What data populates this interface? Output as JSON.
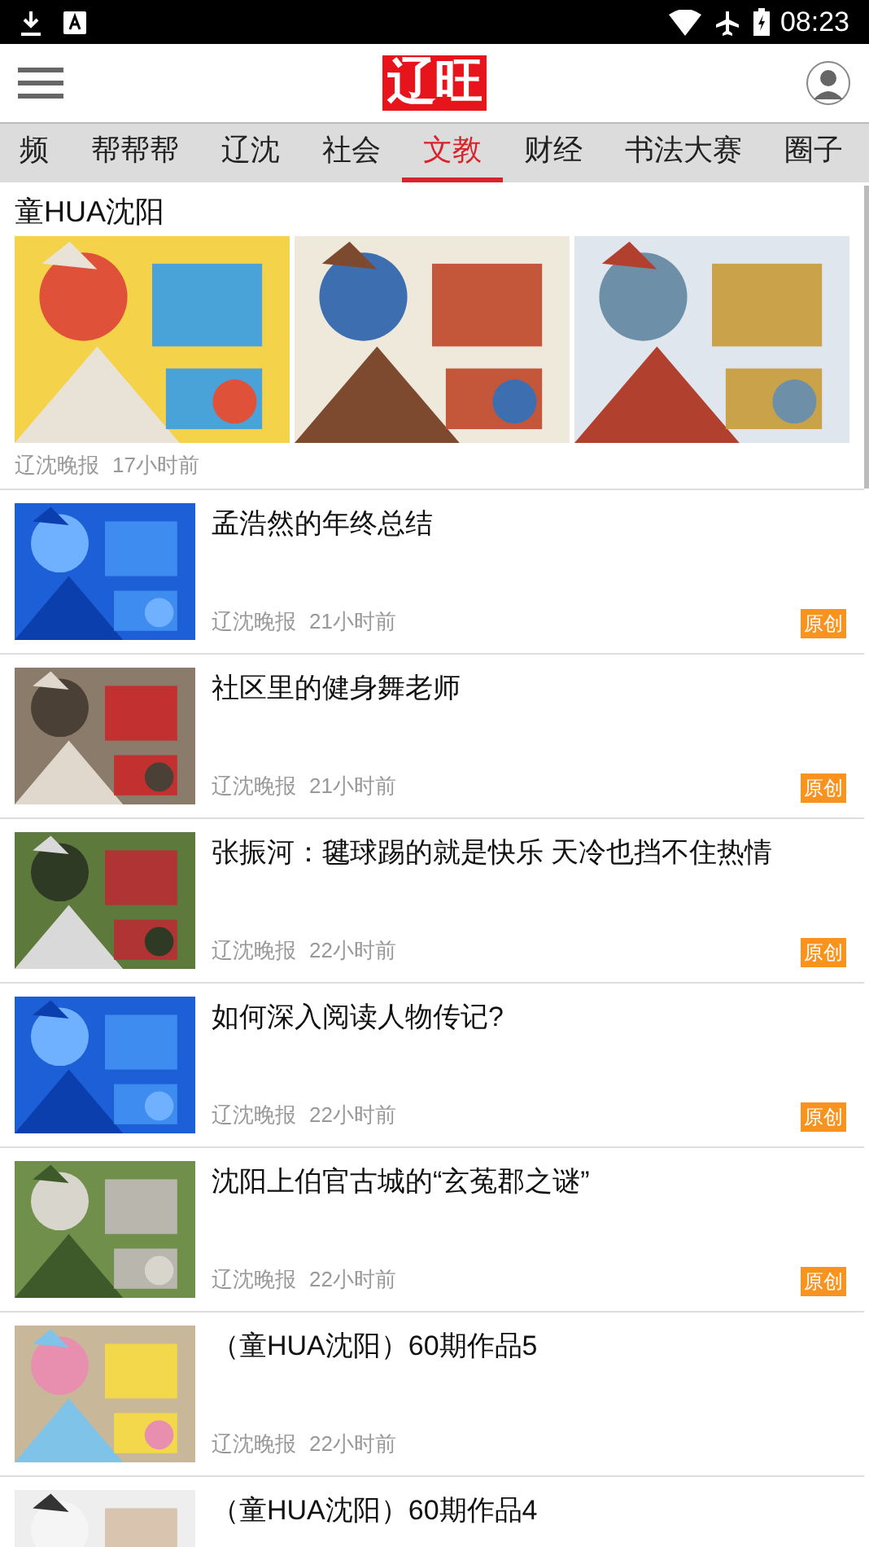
{
  "status_bar": {
    "time": "08:23"
  },
  "header": {
    "logo": "辽旺"
  },
  "tabs": [
    {
      "label": "频",
      "selected": false
    },
    {
      "label": "帮帮帮",
      "selected": false
    },
    {
      "label": "辽沈",
      "selected": false
    },
    {
      "label": "社会",
      "selected": false
    },
    {
      "label": "文教",
      "selected": true
    },
    {
      "label": "财经",
      "selected": false
    },
    {
      "label": "书法大赛",
      "selected": false
    },
    {
      "label": "圈子",
      "selected": false
    }
  ],
  "featured": {
    "title": "童HUA沈阳",
    "source": "辽沈晚报",
    "time": "17小时前"
  },
  "articles": [
    {
      "title": "孟浩然的年终总结",
      "source": "辽沈晚报",
      "time": "21小时前",
      "badge": "原创"
    },
    {
      "title": "社区里的健身舞老师",
      "source": "辽沈晚报",
      "time": "21小时前",
      "badge": "原创"
    },
    {
      "title": "张振河：毽球踢的就是快乐 天冷也挡不住热情",
      "source": "辽沈晚报",
      "time": "22小时前",
      "badge": "原创"
    },
    {
      "title": "如何深入阅读人物传记?",
      "source": "辽沈晚报",
      "time": "22小时前",
      "badge": "原创"
    },
    {
      "title": "沈阳上伯官古城的“玄菟郡之谜”",
      "source": "辽沈晚报",
      "time": "22小时前",
      "badge": "原创"
    },
    {
      "title": "（童HUA沈阳）60期作品5",
      "source": "辽沈晚报",
      "time": "22小时前"
    },
    {
      "title": "（童HUA沈阳）60期作品4"
    }
  ]
}
